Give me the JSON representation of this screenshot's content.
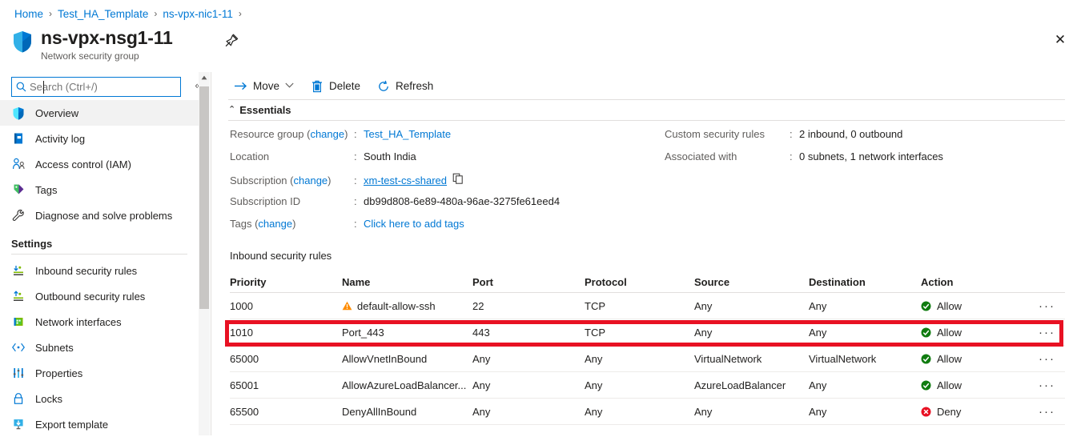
{
  "breadcrumb": {
    "items": [
      {
        "label": "Home"
      },
      {
        "label": "Test_HA_Template"
      },
      {
        "label": "ns-vpx-nic1-11"
      }
    ],
    "separator": "›"
  },
  "header": {
    "title": "ns-vpx-nsg1-11",
    "subtitle": "Network security group",
    "resource_icon": "shield-icon",
    "pin_icon": "pin-icon",
    "close_icon": "close-icon",
    "close_glyph": "✕"
  },
  "sidebar": {
    "search": {
      "value": "",
      "placeholder": "Search (Ctrl+/)",
      "icon": "search-icon"
    },
    "collapse": {
      "icon": "double-chevron-left-icon",
      "glyph": "«"
    },
    "scroll_up_glyph": "▲",
    "items": [
      {
        "label": "Overview",
        "icon": "shield-icon",
        "selected": true
      },
      {
        "label": "Activity log",
        "icon": "activity-log-icon",
        "selected": false
      },
      {
        "label": "Access control (IAM)",
        "icon": "people-icon",
        "selected": false
      },
      {
        "label": "Tags",
        "icon": "tag-icon",
        "selected": false
      },
      {
        "label": "Diagnose and solve problems",
        "icon": "wrench-icon",
        "selected": false
      }
    ],
    "group_label": "Settings",
    "settings_items": [
      {
        "label": "Inbound security rules",
        "icon": "inbound-rules-icon"
      },
      {
        "label": "Outbound security rules",
        "icon": "outbound-rules-icon"
      },
      {
        "label": "Network interfaces",
        "icon": "network-interface-icon"
      },
      {
        "label": "Subnets",
        "icon": "subnet-icon"
      },
      {
        "label": "Properties",
        "icon": "properties-icon"
      },
      {
        "label": "Locks",
        "icon": "lock-icon"
      },
      {
        "label": "Export template",
        "icon": "export-template-icon"
      }
    ]
  },
  "toolbar": {
    "move_label": "Move",
    "move_icon": "arrow-right-icon",
    "move_chevron": "∨",
    "delete_label": "Delete",
    "delete_icon": "trash-icon",
    "refresh_label": "Refresh",
    "refresh_icon": "refresh-icon"
  },
  "essentials": {
    "title": "Essentials",
    "caret": "⌃",
    "colon": ":",
    "left": [
      {
        "key": "Resource group",
        "key_link": "change",
        "value": "Test_HA_Template",
        "value_kind": "link"
      },
      {
        "key": "Location",
        "key_link": "",
        "value": "South India",
        "value_kind": "text"
      },
      {
        "key": "Subscription",
        "key_link": "change",
        "value": "xm-test-cs-shared",
        "value_kind": "link-underline",
        "copy_icon": "copy-icon"
      },
      {
        "key": "Subscription ID",
        "key_link": "",
        "value": "db99d808-6e89-480a-96ae-3275fe61eed4",
        "value_kind": "text"
      },
      {
        "key": "Tags",
        "key_link": "change",
        "value": "Click here to add tags",
        "value_kind": "link"
      }
    ],
    "right": [
      {
        "key": "Custom security rules",
        "value": "2 inbound, 0 outbound"
      },
      {
        "key": "Associated with",
        "value": "0 subnets, 1 network interfaces"
      }
    ]
  },
  "table": {
    "title": "Inbound security rules",
    "columns": [
      "Priority",
      "Name",
      "Port",
      "Protocol",
      "Source",
      "Destination",
      "Action"
    ],
    "more_glyph": "···",
    "rows": [
      {
        "priority": "1000",
        "name": "default-allow-ssh",
        "name_icon": "warning-icon",
        "port": "22",
        "protocol": "TCP",
        "source": "Any",
        "destination": "Any",
        "action": "Allow",
        "action_icon": "allow-check-icon",
        "highlighted": false
      },
      {
        "priority": "1010",
        "name": "Port_443",
        "name_icon": "",
        "port": "443",
        "protocol": "TCP",
        "source": "Any",
        "destination": "Any",
        "action": "Allow",
        "action_icon": "allow-check-icon",
        "highlighted": true
      },
      {
        "priority": "65000",
        "name": "AllowVnetInBound",
        "name_icon": "",
        "port": "Any",
        "protocol": "Any",
        "source": "VirtualNetwork",
        "destination": "VirtualNetwork",
        "action": "Allow",
        "action_icon": "allow-check-icon",
        "highlighted": false
      },
      {
        "priority": "65001",
        "name": "AllowAzureLoadBalancer...",
        "name_icon": "",
        "port": "Any",
        "protocol": "Any",
        "source": "AzureLoadBalancer",
        "destination": "Any",
        "action": "Allow",
        "action_icon": "allow-check-icon",
        "highlighted": false
      },
      {
        "priority": "65500",
        "name": "DenyAllInBound",
        "name_icon": "",
        "port": "Any",
        "protocol": "Any",
        "source": "Any",
        "destination": "Any",
        "action": "Deny",
        "action_icon": "deny-x-icon",
        "highlighted": false
      }
    ]
  },
  "annotation": {
    "color": "#e81123",
    "target": "row-1010-port-443"
  },
  "colors": {
    "accent": "#0078d4",
    "allow": "#107c10",
    "deny": "#e81123",
    "warning": "#ff8c00",
    "annotation": "#e81123",
    "text": "#201f1e",
    "muted": "#605e5c"
  }
}
